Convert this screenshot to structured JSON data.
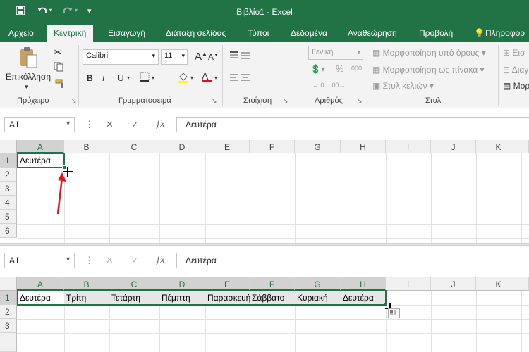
{
  "window": {
    "title": "Βιβλίο1 - Excel"
  },
  "quick_access": {
    "save_icon": "save-icon",
    "undo_icon": "undo-icon",
    "redo_icon": "redo-icon",
    "customize_icon": "chevron-down-icon"
  },
  "tabs": [
    "Αρχείο",
    "Κεντρική",
    "Εισαγωγή",
    "Διάταξη σελίδας",
    "Τύποι",
    "Δεδομένα",
    "Αναθεώρηση",
    "Προβολή",
    "Πληροφορ"
  ],
  "active_tab": "Κεντρική",
  "ribbon": {
    "clipboard": {
      "paste_label": "Επικόλληση",
      "group_label": "Πρόχειρο"
    },
    "font": {
      "name": "Calibri",
      "size": "11",
      "group_label": "Γραμματοσειρά",
      "bold": "B",
      "italic": "I",
      "underline": "U",
      "grow": "A",
      "shrink": "A",
      "font_color": "A"
    },
    "alignment": {
      "group_label": "Στοίχιση"
    },
    "number": {
      "format": "Γενική",
      "percent": "%",
      "thousands": "000",
      "group_label": "Αριθμός"
    },
    "styles": {
      "conditional": "Μορφοποίηση υπό όρους",
      "as_table": "Μορφοποίηση ως πίνακα",
      "cell_styles": "Στυλ κελιών",
      "group_label": "Στυλ"
    },
    "cells": {
      "insert": "Εισ",
      "delete": "Διαγ",
      "format": "Μορ"
    }
  },
  "formula_bars": [
    {
      "name_box": "A1",
      "cancel": "✕",
      "enter": "✓",
      "fx": "fx",
      "content": "Δευτέρα"
    },
    {
      "name_box": "A1",
      "cancel": "✕",
      "enter": "✓",
      "fx": "fx",
      "content": "Δευτέρα"
    }
  ],
  "columns": [
    "A",
    "B",
    "C",
    "D",
    "E",
    "F",
    "G",
    "H",
    "I",
    "J",
    "K"
  ],
  "top_pane": {
    "rows": [
      "1",
      "2",
      "3",
      "4",
      "5",
      "6"
    ],
    "cells": {
      "A1": "Δευτέρα"
    }
  },
  "bottom_pane": {
    "rows": [
      "1",
      "2",
      "3"
    ],
    "cells": [
      "Δευτέρα",
      "Τρίτη",
      "Τετάρτη",
      "Πέμπτη",
      "Παρασκευή",
      "Σάββατο",
      "Κυριακή",
      "Δευτέρα"
    ]
  },
  "colors": {
    "excel_green": "#217346",
    "annotation_red": "#e8101a"
  }
}
